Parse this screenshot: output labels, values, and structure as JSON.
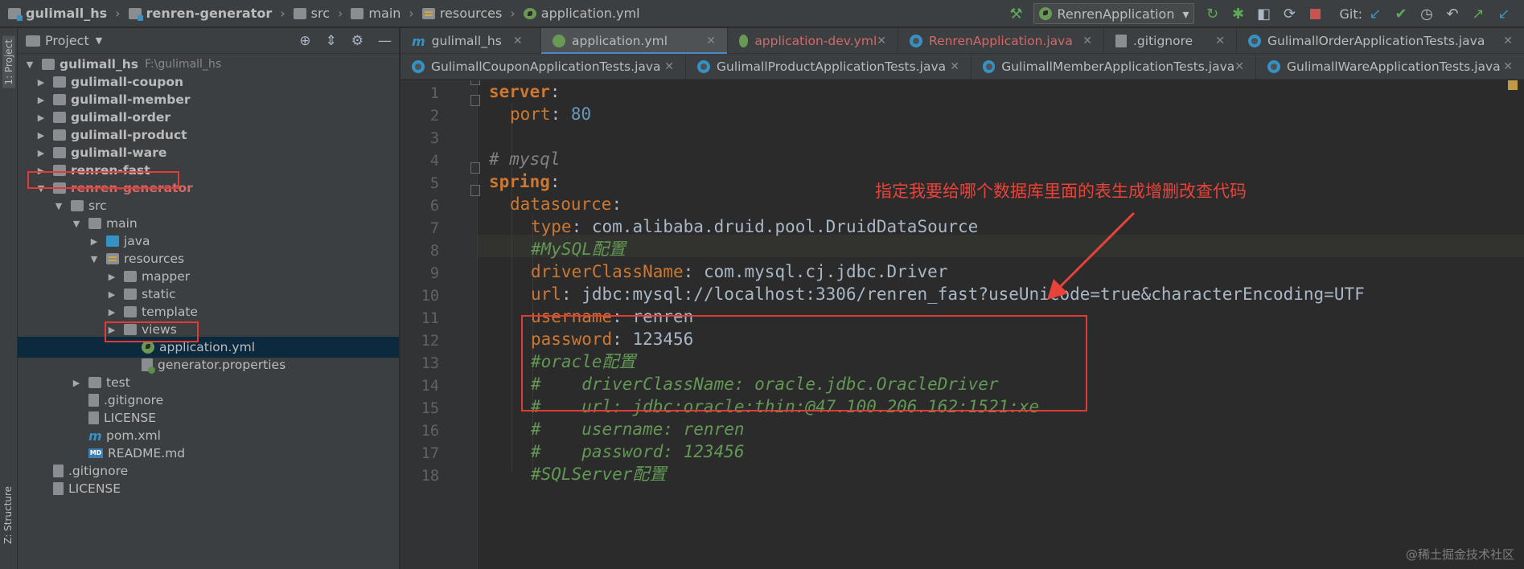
{
  "breadcrumb": [
    "gulimall_hs",
    "renren-generator",
    "src",
    "main",
    "resources",
    "application.yml"
  ],
  "toolbar": {
    "run_config": "RenrenApplication",
    "git_label": "Git:"
  },
  "left_strip": {
    "project_label": "1: Project",
    "structure_label": "Z: Structure"
  },
  "project_panel": {
    "title": "Project",
    "root": {
      "name": "gulimall_hs",
      "path": "F:\\gulimall_hs"
    },
    "items": [
      {
        "label": "gulimall-coupon"
      },
      {
        "label": "gulimall-member"
      },
      {
        "label": "gulimall-order"
      },
      {
        "label": "gulimall-product"
      },
      {
        "label": "gulimall-ware"
      },
      {
        "label": "renren-fast"
      },
      {
        "label": "renren-generator"
      },
      {
        "label": "src"
      },
      {
        "label": "main"
      },
      {
        "label": "java"
      },
      {
        "label": "resources"
      },
      {
        "label": "mapper"
      },
      {
        "label": "static"
      },
      {
        "label": "template"
      },
      {
        "label": "views"
      },
      {
        "label": "application.yml"
      },
      {
        "label": "generator.properties"
      },
      {
        "label": "test"
      },
      {
        "label": ".gitignore"
      },
      {
        "label": "LICENSE"
      },
      {
        "label": "pom.xml"
      },
      {
        "label": "README.md"
      },
      {
        "label": ".gitignore"
      },
      {
        "label": "LICENSE"
      }
    ]
  },
  "tabs_row1": [
    {
      "label": "gulimall_hs"
    },
    {
      "label": "application.yml"
    },
    {
      "label": "application-dev.yml"
    },
    {
      "label": "RenrenApplication.java"
    },
    {
      "label": ".gitignore"
    },
    {
      "label": "GulimallOrderApplicationTests.java"
    }
  ],
  "tabs_row2": [
    {
      "label": "GulimallCouponApplicationTests.java"
    },
    {
      "label": "GulimallProductApplicationTests.java"
    },
    {
      "label": "GulimallMemberApplicationTests.java"
    },
    {
      "label": "GulimallWareApplicationTests.java"
    }
  ],
  "line_numbers": [
    "1",
    "2",
    "3",
    "4",
    "5",
    "6",
    "7",
    "8",
    "9",
    "10",
    "11",
    "12",
    "13",
    "14",
    "15",
    "16",
    "17",
    "18"
  ],
  "code": {
    "l1_key": "server",
    "l2_key": "port",
    "l2_val": "80",
    "l4_comment": "# mysql",
    "l5_key": "spring",
    "l6_key": "datasource",
    "l7_key": "type",
    "l7_val": "com.alibaba.druid.pool.DruidDataSource",
    "l8_comment": "#MySQL配置",
    "l9_key": "driverClassName",
    "l9_val": "com.mysql.cj.jdbc.Driver",
    "l10_key": "url",
    "l10_val": "jdbc:mysql://localhost:3306/renren_fast?useUnicode=true&characterEncoding=UTF",
    "l11_key": "username",
    "l11_val": "renren",
    "l12_key": "password",
    "l12_val": "123456",
    "l13_comment": "#oracle配置",
    "l14_comment": "#    driverClassName: oracle.jdbc.OracleDriver",
    "l15_comment": "#    url: jdbc:oracle:thin:@47.100.206.162:1521:xe",
    "l16_comment": "#    username: renren",
    "l17_comment": "#    password: 123456",
    "l18_comment": "#SQLServer配置"
  },
  "annotation_text": "指定我要给哪个数据库里面的表生成增删改查代码",
  "watermark": "@稀土掘金技术社区"
}
